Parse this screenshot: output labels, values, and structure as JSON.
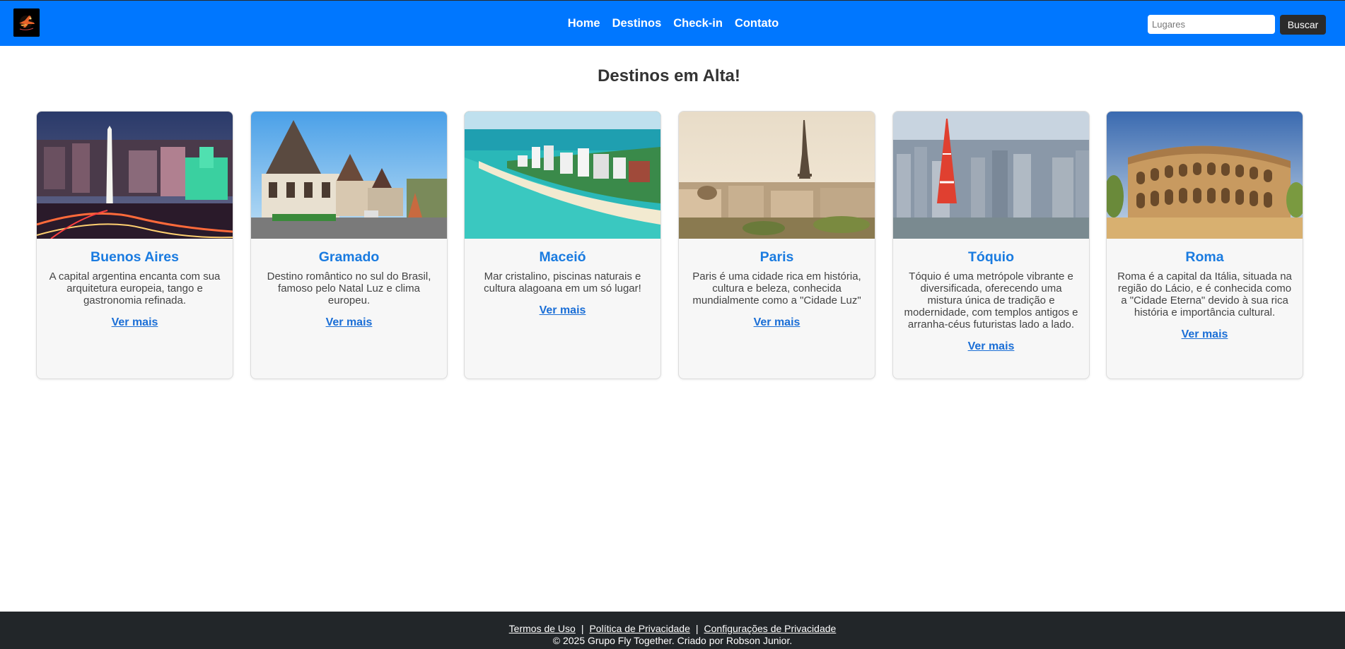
{
  "header": {
    "logo_icon": "airplane-logo-icon",
    "nav": [
      {
        "label": "Home"
      },
      {
        "label": "Destinos"
      },
      {
        "label": "Check-in"
      },
      {
        "label": "Contato"
      }
    ],
    "search": {
      "placeholder": "Lugares",
      "value": "",
      "button_label": "Buscar"
    },
    "colors": {
      "background": "#0077ff",
      "button": "#2b2b2b"
    }
  },
  "main": {
    "title": "Destinos em Alta!",
    "cards": [
      {
        "title": "Buenos Aires",
        "description": "A capital argentina encanta com sua arquitetura europeia, tango e gastronomia refinada.",
        "link": "Ver mais"
      },
      {
        "title": "Gramado",
        "description": "Destino romântico no sul do Brasil, famoso pelo Natal Luz e clima europeu.",
        "link": "Ver mais"
      },
      {
        "title": "Maceió",
        "description": "Mar cristalino, piscinas naturais e cultura alagoana em um só lugar!",
        "link": "Ver mais"
      },
      {
        "title": "Paris",
        "description": "Paris é uma cidade rica em história, cultura e beleza, conhecida mundialmente como a \"Cidade Luz\"",
        "link": "Ver mais"
      },
      {
        "title": "Tóquio",
        "description": "Tóquio é uma metrópole vibrante e diversificada, oferecendo uma mistura única de tradição e modernidade, com templos antigos e arranha-céus futuristas lado a lado.",
        "link": "Ver mais"
      },
      {
        "title": "Roma",
        "description": "Roma é a capital da Itália, situada na região do Lácio, e é conhecida como a \"Cidade Eterna\" devido à sua rica história e importância cultural.",
        "link": "Ver mais"
      }
    ],
    "colors": {
      "card_title": "#1a7be0",
      "link": "#1a6ed6"
    }
  },
  "footer": {
    "links": [
      {
        "label": "Termos de Uso"
      },
      {
        "label": "Política de Privacidade"
      },
      {
        "label": "Configurações de Privacidade"
      }
    ],
    "separator": "|",
    "copyright": "© 2025 Grupo Fly Together. Criado por Robson Junior.",
    "colors": {
      "background": "#222629"
    }
  }
}
